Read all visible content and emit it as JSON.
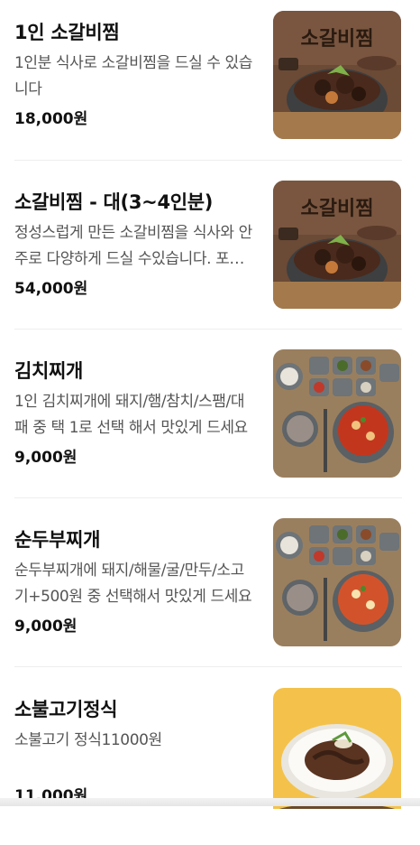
{
  "menu": {
    "items": [
      {
        "name": "1인 소갈비찜",
        "description": "1인분 식사로 소갈비찜을 드실 수 있습니다",
        "price": "18,000원",
        "image": {
          "kind": "galbijjim-poster",
          "caption": "소갈비찜",
          "background": "#6b4a36"
        }
      },
      {
        "name": "소갈비찜 - 대(3~4인분)",
        "description": "정성스럽게 만든 소갈비찜을 식사와 안주로 다양하게 드실 수있습니다. 포장시 추가금액 발생",
        "price": "54,000원",
        "image": {
          "kind": "galbijjim-poster",
          "caption": "소갈비찜",
          "background": "#6b4a36"
        }
      },
      {
        "name": "김치찌개",
        "description": "1인 김치찌개에 돼지/햄/참치/스팸/대패 중 택 1로 선택 해서 맛있게 드세요",
        "price": "9,000원",
        "image": {
          "kind": "stew-set",
          "background": "#8a8f93"
        }
      },
      {
        "name": "순두부찌개",
        "description": "순두부찌개에 돼지/해물/굴/만두/소고기+500원 중 선택해서 맛있게 드세요",
        "price": "9,000원",
        "image": {
          "kind": "stew-set",
          "background": "#8a8f93"
        }
      },
      {
        "name": "소불고기정식",
        "description": "소불고기 정식11000원",
        "price": "11,000원",
        "image": {
          "kind": "bulgogi-plate",
          "background": "#f4c24a"
        }
      }
    ]
  }
}
